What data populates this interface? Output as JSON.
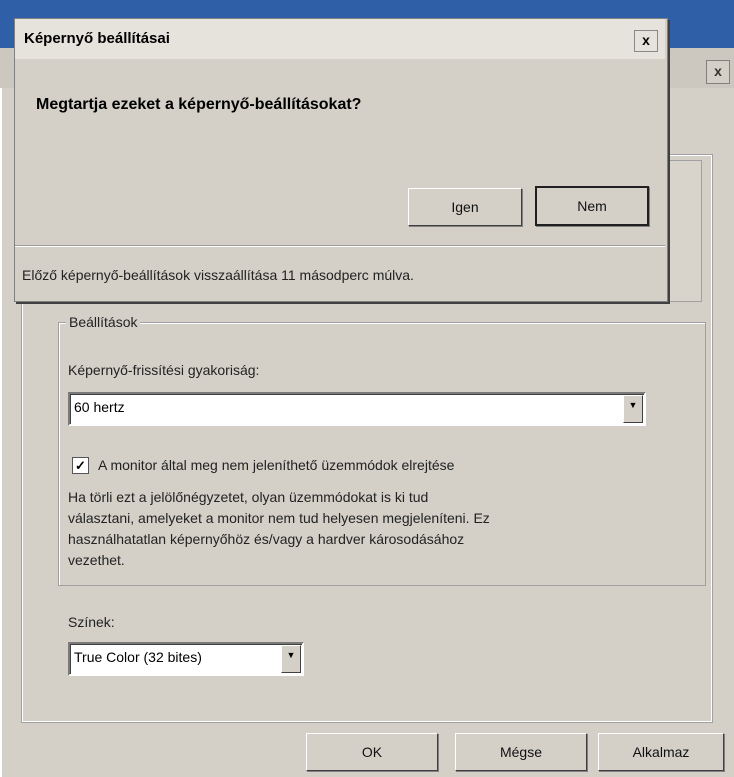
{
  "back_window": {
    "close_glyph": "x",
    "settings_group_label": "Beállítások",
    "refresh_rate_label": "Képernyő-frissítési gyakoriság:",
    "refresh_rate_value": "60 hertz",
    "hide_modes_checked": true,
    "hide_modes_label": "A monitor által meg nem jeleníthető üzemmódok elrejtése",
    "hide_modes_description": [
      "Ha törli ezt a jelölőnégyzetet, olyan üzemmódokat is ki tud",
      "választani, amelyeket a monitor nem tud helyesen megjeleníteni. Ez",
      "használhatatlan képernyőhöz és/vagy a hardver károsodásához",
      "vezethet."
    ],
    "colors_label": "Színek:",
    "colors_value": "True Color (32 bites)",
    "buttons": {
      "ok": "OK",
      "cancel": "Mégse",
      "apply": "Alkalmaz"
    }
  },
  "dialog": {
    "title": "Képernyő beállításai",
    "close_glyph": "x",
    "question": "Megtartja ezeket a képernyő-beállításokat?",
    "yes_label": "Igen",
    "no_label": "Nem",
    "status": "Előző képernyő-beállítások visszaállítása 11 másodperc múlva."
  },
  "icons": {
    "check": "✓",
    "combo_arrow": "▼"
  }
}
